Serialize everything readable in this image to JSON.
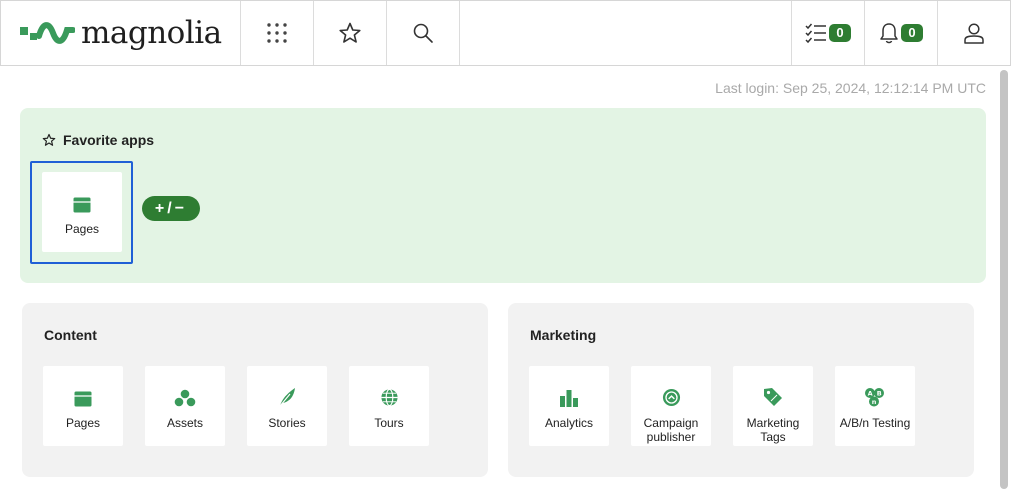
{
  "header": {
    "logo_text": "magnolia",
    "tasks_count": "0",
    "notifications_count": "0"
  },
  "last_login": "Last login: Sep 25, 2024, 12:12:14 PM UTC",
  "favorites": {
    "title": "Favorite apps",
    "apps": [
      {
        "label": "Pages",
        "icon": "pages-icon"
      }
    ],
    "edit_button_label": "+/−"
  },
  "groups": {
    "content": {
      "title": "Content",
      "apps": [
        {
          "label": "Pages",
          "icon": "pages-icon"
        },
        {
          "label": "Assets",
          "icon": "assets-icon"
        },
        {
          "label": "Stories",
          "icon": "stories-icon"
        },
        {
          "label": "Tours",
          "icon": "tours-icon"
        }
      ]
    },
    "marketing": {
      "title": "Marketing",
      "apps": [
        {
          "label": "Analytics",
          "icon": "analytics-icon"
        },
        {
          "label": "Campaign publisher",
          "icon": "campaign-publisher-icon"
        },
        {
          "label": "Marketing Tags",
          "icon": "marketing-tags-icon"
        },
        {
          "label": "A/B/n Testing",
          "icon": "ab-testing-icon"
        }
      ]
    }
  },
  "colors": {
    "accent": "#2e7d32",
    "favorites_bg": "#e3f4e4",
    "group_bg": "#f2f2f2",
    "icon_green": "#3a9a5b",
    "focus_border": "#1f5fd6"
  }
}
